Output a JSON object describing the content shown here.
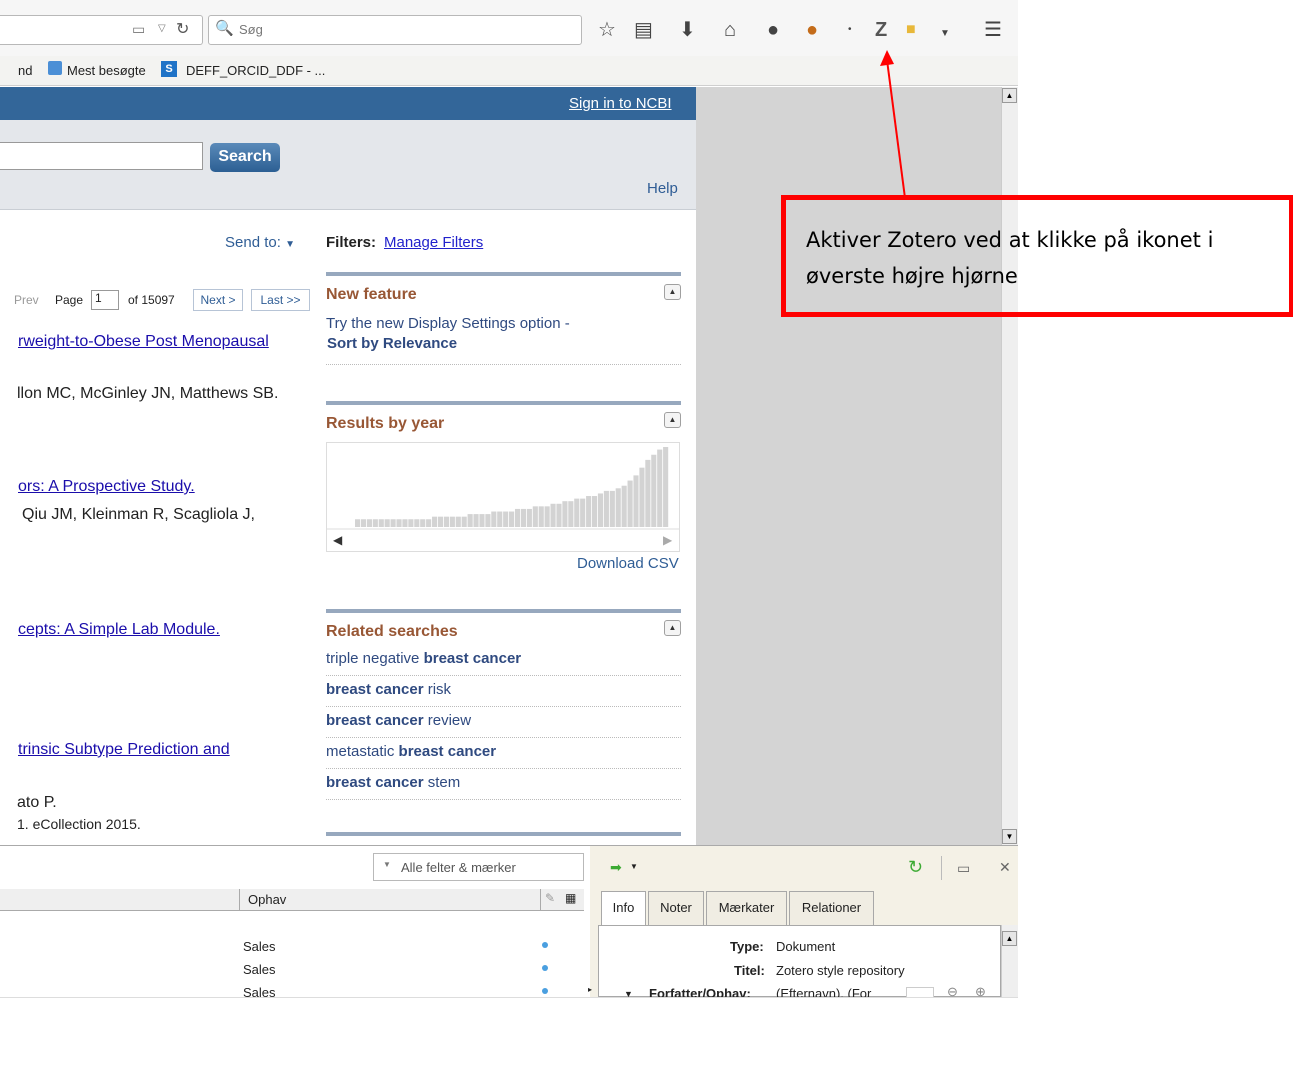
{
  "browser": {
    "search_placeholder": "Søg",
    "bookmarks": {
      "item0": "nd",
      "item1": "Mest besøgte",
      "item2": "DEFF_ORCID_DDF - ..."
    }
  },
  "ncbi": {
    "sign_in": "Sign in to NCBI",
    "search_button": "Search",
    "help": "Help",
    "send_to": "Send to:",
    "filters_label": "Filters:",
    "manage_filters": "Manage Filters",
    "pager": {
      "prev": "Prev",
      "page_label": "Page",
      "page_value": "1",
      "of_total": "of 15097",
      "next": "Next >",
      "last": "Last >>"
    },
    "results": [
      {
        "title": "rweight-to-Obese Post Menopausal",
        "authors": "llon MC, McGinley JN, Matthews SB."
      },
      {
        "title": "ors: A Prospective Study.",
        "authors": "Qiu JM, Kleinman R, Scagliola J,"
      },
      {
        "title": "cepts: A Simple Lab Module.",
        "authors": ""
      },
      {
        "title": "trinsic Subtype Prediction and",
        "authors": "ato P.",
        "citation": "1. eCollection 2015."
      }
    ],
    "new_feature": {
      "title": "New feature",
      "line1": "Try the new Display Settings option -",
      "line2": "Sort by Relevance"
    },
    "results_by_year": {
      "title": "Results by year",
      "download": "Download CSV"
    },
    "related": {
      "title": "Related searches",
      "items": [
        {
          "pre": "triple negative ",
          "bold": "breast cancer",
          "post": ""
        },
        {
          "pre": "",
          "bold": "breast cancer",
          "post": " risk"
        },
        {
          "pre": "",
          "bold": "breast cancer",
          "post": " review"
        },
        {
          "pre": "metastatic ",
          "bold": "breast cancer",
          "post": ""
        },
        {
          "pre": "",
          "bold": "breast cancer",
          "post": " stem"
        }
      ]
    }
  },
  "chart_data": {
    "type": "bar",
    "title": "Results by year",
    "values": [
      3,
      3,
      3,
      3,
      3,
      3,
      3,
      3,
      3,
      3,
      3,
      3,
      3,
      4,
      4,
      4,
      4,
      4,
      4,
      5,
      5,
      5,
      5,
      6,
      6,
      6,
      6,
      7,
      7,
      7,
      8,
      8,
      8,
      9,
      9,
      10,
      10,
      11,
      11,
      12,
      12,
      13,
      14,
      14,
      15,
      16,
      18,
      20,
      23,
      26,
      28,
      30,
      31
    ]
  },
  "zotero": {
    "search_placeholder": "Alle felter & mærker",
    "column_ophav": "Ophav",
    "rows": [
      "Sales",
      "Sales",
      "Sales"
    ],
    "tabs": [
      "Info",
      "Noter",
      "Mærkater",
      "Relationer"
    ],
    "info": {
      "type_label": "Type:",
      "type_value": "Dokument",
      "title_label": "Titel:",
      "title_value": "Zotero style repository",
      "author_label": "Forfatter/Ophav:",
      "author_value": "(Efternavn), (For"
    }
  },
  "callout": {
    "text": "Aktiver Zotero ved at klikke på ikonet i øverste højre hjørne"
  }
}
